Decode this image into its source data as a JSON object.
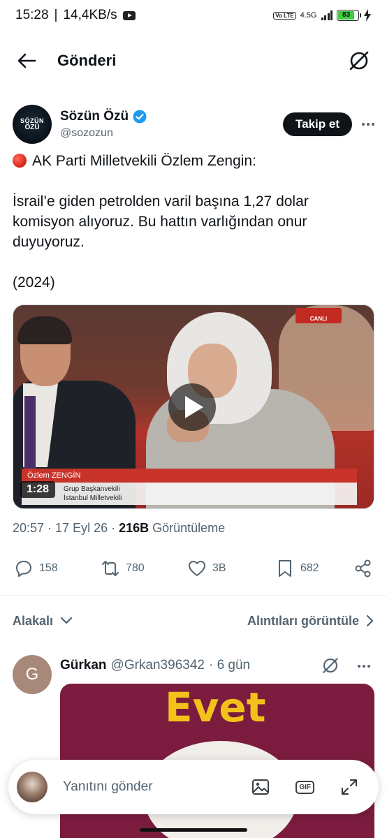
{
  "status_bar": {
    "time": "15:28",
    "net_speed": "14,4KB/s",
    "network": "4.5G",
    "volte": "Vo LTE",
    "battery": "83"
  },
  "header": {
    "title": "Gönderi"
  },
  "post": {
    "author_name": "Sözün Özü",
    "author_handle": "@sozozun",
    "avatar_text_top": "SÖZÜN",
    "avatar_text_bottom": "ÖZÜ",
    "follow_label": "Takip et",
    "line1": "AK Parti Milletvekili Özlem Zengin:",
    "line2": "İsrail’e giden petrolden varil başına 1,27 dolar komisyon alıyoruz. Bu hattın varlığından onur duyuyoruz.",
    "line3": "(2024)",
    "timestamp": "20:57 · 17 Eyl 26 · ",
    "views_count": "216B",
    "views_label": " Görüntüleme",
    "video": {
      "duration": "1:28",
      "overlay_name": "Özlem ZENGİN",
      "overlay_role_1": "Grup Başkanvekili",
      "overlay_role_2": "İstanbul Milletvekili",
      "channel_tag": "CANLI"
    }
  },
  "actions": {
    "replies": "158",
    "reposts": "780",
    "likes": "3B",
    "bookmarks": "682"
  },
  "related": {
    "left_label": "Alakalı",
    "right_label": "Alıntıları görüntüle"
  },
  "reply": {
    "avatar_letter": "G",
    "name": "Gürkan",
    "handle": "@Grkan396342",
    "age": "· 6 gün",
    "image_text": "Evet"
  },
  "composer": {
    "placeholder": "Yanıtını gönder",
    "gif_label": "GIF"
  },
  "colors": {
    "text": "#0f1419",
    "muted": "#536471",
    "verified": "#1d9bf0",
    "follow_bg": "#0f1419"
  }
}
